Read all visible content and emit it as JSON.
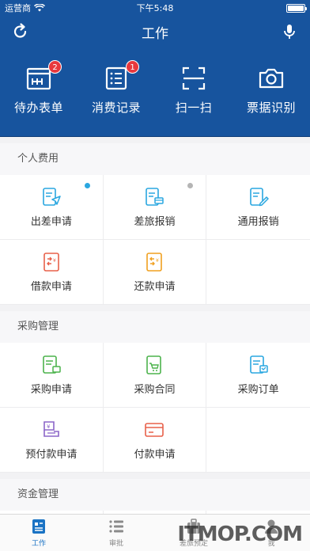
{
  "status": {
    "carrier": "运营商",
    "time": "下午5:48"
  },
  "navbar": {
    "title": "工作"
  },
  "quick_actions": [
    {
      "label": "待办表单",
      "badge": "2",
      "icon": "form-icon"
    },
    {
      "label": "消费记录",
      "badge": "1",
      "icon": "list-icon"
    },
    {
      "label": "扫一扫",
      "badge": "",
      "icon": "scan-icon"
    },
    {
      "label": "票据识别",
      "badge": "",
      "icon": "camera-icon"
    }
  ],
  "sections": [
    {
      "title": "个人费用",
      "items": [
        {
          "label": "出差申请",
          "icon": "travel-request-icon",
          "color": "#2aa7e0",
          "dot": "#2aa7e0"
        },
        {
          "label": "差旅报销",
          "icon": "travel-reimburse-icon",
          "color": "#2aa7e0",
          "dot": "#b5b5b5"
        },
        {
          "label": "通用报销",
          "icon": "general-reimburse-icon",
          "color": "#2aa7e0",
          "dot": ""
        },
        {
          "label": "借款申请",
          "icon": "loan-request-icon",
          "color": "#e8604a",
          "dot": ""
        },
        {
          "label": "还款申请",
          "icon": "repay-request-icon",
          "color": "#f0a020",
          "dot": ""
        }
      ]
    },
    {
      "title": "采购管理",
      "items": [
        {
          "label": "采购申请",
          "icon": "purchase-request-icon",
          "color": "#4cb34c",
          "dot": ""
        },
        {
          "label": "采购合同",
          "icon": "purchase-contract-icon",
          "color": "#4cb34c",
          "dot": ""
        },
        {
          "label": "采购订单",
          "icon": "purchase-order-icon",
          "color": "#2aa7e0",
          "dot": ""
        },
        {
          "label": "预付款申请",
          "icon": "prepayment-icon",
          "color": "#8c66c8",
          "dot": ""
        },
        {
          "label": "付款申请",
          "icon": "payment-icon",
          "color": "#e8604a",
          "dot": ""
        }
      ]
    },
    {
      "title": "资金管理",
      "items": []
    }
  ],
  "tabs": [
    {
      "label": "工作",
      "icon": "work-icon",
      "active": true
    },
    {
      "label": "审批",
      "icon": "approval-icon",
      "active": false
    },
    {
      "label": "差旅预定",
      "icon": "luggage-icon",
      "active": false
    },
    {
      "label": "我",
      "icon": "profile-icon",
      "active": false
    }
  ],
  "watermark": "ITMOP.COM"
}
